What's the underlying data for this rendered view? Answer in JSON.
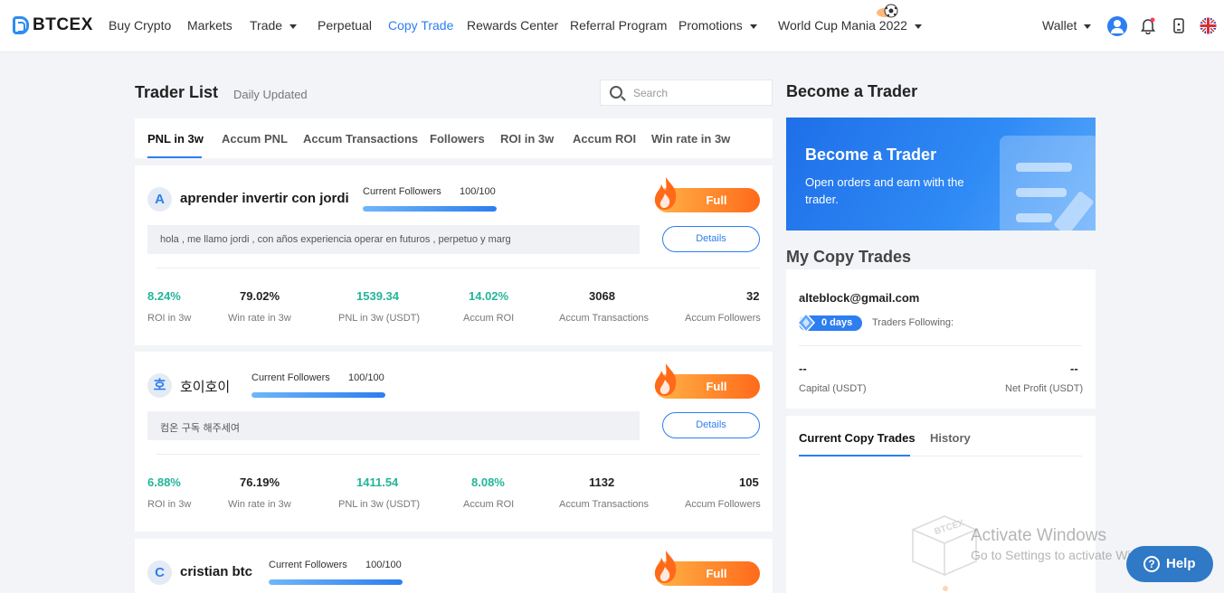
{
  "nav": {
    "brand": "BTCEX",
    "items": [
      {
        "label": "Buy Crypto",
        "dropdown": false,
        "active": false
      },
      {
        "label": "Markets",
        "dropdown": false,
        "active": false
      },
      {
        "label": "Trade",
        "dropdown": true,
        "active": false
      },
      {
        "label": "Perpetual",
        "dropdown": false,
        "active": false
      },
      {
        "label": "Copy Trade",
        "dropdown": false,
        "active": true
      },
      {
        "label": "Rewards Center",
        "dropdown": false,
        "active": false
      },
      {
        "label": "Referral Program",
        "dropdown": false,
        "active": false
      },
      {
        "label": "Promotions",
        "dropdown": true,
        "active": false
      },
      {
        "label": "World Cup Mania 2022",
        "dropdown": true,
        "active": false
      }
    ],
    "wallet": "Wallet",
    "icons": [
      "user-avatar-icon",
      "notification-bell-icon",
      "mobile-app-icon",
      "language-flag-icon"
    ],
    "accent": "#2d7ef0"
  },
  "trader_list": {
    "title": "Trader List",
    "subtitle": "Daily Updated",
    "search_placeholder": "Search",
    "tabs": [
      "PNL in 3w",
      "Accum PNL",
      "Accum Transactions",
      "Followers",
      "ROI in 3w",
      "Accum ROI",
      "Win rate in 3w"
    ],
    "active_tab": "PNL in 3w",
    "current_followers_label": "Current Followers",
    "full_label": "Full",
    "details_label": "Details",
    "stat_labels": [
      "ROI in 3w",
      "Win rate in 3w",
      "PNL in 3w (USDT)",
      "Accum ROI",
      "Accum Transactions",
      "Accum Followers"
    ],
    "traders": [
      {
        "initial": "A",
        "name": "aprender invertir con jordi",
        "followers": "100/100",
        "followers_fill": 1.0,
        "description": "hola , me llamo jordi , con años experiencia operar en futuros , perpetuo y marg",
        "stats": [
          "8.24%",
          "79.02%",
          "1539.34",
          "14.02%",
          "3068",
          "32"
        ]
      },
      {
        "initial": "호",
        "name": "호이호이",
        "followers": "100/100",
        "followers_fill": 1.0,
        "description": "컴온 구독 해주세여",
        "stats": [
          "6.88%",
          "76.19%",
          "1411.54",
          "8.08%",
          "1132",
          "105"
        ]
      },
      {
        "initial": "C",
        "name": "cristian btc",
        "followers": "100/100",
        "followers_fill": 1.0,
        "description": "",
        "stats": []
      }
    ]
  },
  "become_trader": {
    "title": "Become a Trader",
    "banner_title": "Become a Trader",
    "banner_text": "Open orders and earn with the trader."
  },
  "my_copy_trades": {
    "title": "My Copy Trades",
    "email": "alteblock@gmail.com",
    "days_badge": "0 days",
    "traders_following_label": "Traders Following:",
    "capital_value": "--",
    "capital_label": "Capital (USDT)",
    "net_profit_value": "--",
    "net_profit_label": "Net Profit (USDT)",
    "tabs": [
      "Current Copy Trades",
      "History"
    ],
    "active_tab": "Current Copy Trades",
    "empty_logo_text": "BTCEX"
  },
  "overlay": {
    "watermark_title": "Activate Windows",
    "watermark_text": "Go to Settings to activate Windows.",
    "help_label": "Help"
  }
}
